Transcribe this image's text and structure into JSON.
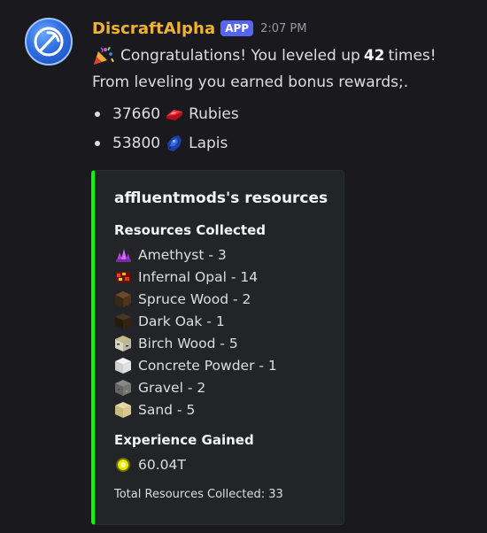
{
  "message": {
    "username": "DiscraftAlpha",
    "badge": "APP",
    "timestamp": "2:07 PM",
    "line1_pre": "Congratulations! You leveled up",
    "line1_count": "42",
    "line1_post": "times!",
    "line2": "From leveling you earned bonus rewards;.",
    "rewards": [
      {
        "amount": "37660",
        "name": "Rubies",
        "icon": "ruby-icon"
      },
      {
        "amount": "53800",
        "name": "Lapis",
        "icon": "lapis-icon"
      }
    ]
  },
  "embed": {
    "accent_color": "#00ff00",
    "title": "affluentmods's resources",
    "resources_heading": "Resources Collected",
    "resources": [
      {
        "text": "Amethyst - 3",
        "icon": "amethyst-icon"
      },
      {
        "text": "Infernal Opal - 14",
        "icon": "infernal-opal-icon"
      },
      {
        "text": "Spruce Wood - 2",
        "icon": "spruce-wood-icon"
      },
      {
        "text": "Dark Oak - 1",
        "icon": "dark-oak-icon"
      },
      {
        "text": "Birch Wood - 5",
        "icon": "birch-wood-icon"
      },
      {
        "text": "Concrete Powder - 1",
        "icon": "concrete-powder-icon"
      },
      {
        "text": "Gravel - 2",
        "icon": "gravel-icon"
      },
      {
        "text": "Sand - 5",
        "icon": "sand-icon"
      }
    ],
    "experience_heading": "Experience Gained",
    "experience_value": "60.04T",
    "footer": "Total Resources Collected: 33"
  }
}
